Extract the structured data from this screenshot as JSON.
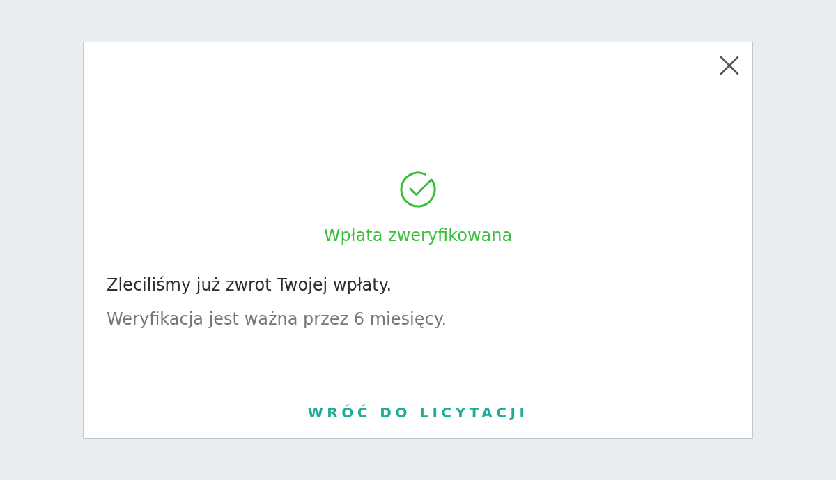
{
  "dialog": {
    "status_title": "Wpłata zweryfikowana",
    "message": "Zleciliśmy już zwrot Twojej wpłaty.",
    "note": "Weryfikacja jest ważna przez 6 miesięcy.",
    "back_button": {
      "label": "WRÓĆ DO LICYTACJI"
    }
  }
}
